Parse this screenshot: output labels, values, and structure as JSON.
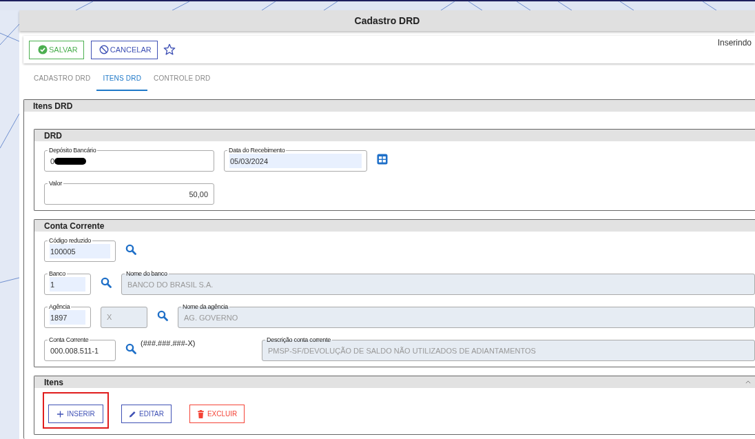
{
  "window": {
    "title": "Cadastro DRD"
  },
  "toolbar": {
    "buttons": [
      {
        "label": "SALVAR",
        "kind": "save"
      },
      {
        "label": "CANCELAR",
        "kind": "cancel"
      }
    ],
    "favorite": false,
    "mode": "Inserindo"
  },
  "tabs": [
    {
      "label": "CADASTRO DRD",
      "selected": false
    },
    {
      "label": "ITENS DRD",
      "selected": true
    },
    {
      "label": "CONTROLE DRD",
      "selected": false
    }
  ],
  "panel": {
    "title": "Itens DRD",
    "sections": [
      {
        "title": "DRD",
        "rows": [
          [
            {
              "kind": "field",
              "label": "Depósito Bancário",
              "value": "0",
              "redacted": true,
              "disabled": false,
              "autofill": false
            },
            {
              "kind": "field",
              "label": "Data do Recebimento",
              "value": "05/03/2024",
              "disabled": false,
              "autofill": true
            },
            {
              "kind": "calendar"
            }
          ],
          [
            {
              "kind": "field",
              "label": "Valor",
              "value": "50,00",
              "numeric": true,
              "disabled": false,
              "autofill": false
            }
          ]
        ]
      },
      {
        "title": "Conta Corrente",
        "rows": [
          [
            {
              "kind": "field",
              "label": "Código reduzido",
              "value": "100005",
              "disabled": false,
              "autofill": true
            },
            {
              "kind": "search"
            }
          ],
          [
            {
              "kind": "field",
              "label": "Banco",
              "value": "1",
              "disabled": false,
              "autofill": true
            },
            {
              "kind": "search"
            },
            {
              "kind": "field",
              "label": "Nome do banco",
              "value": "BANCO DO BRASIL S.A.",
              "disabled": true,
              "autofill": false
            }
          ],
          [
            {
              "kind": "field",
              "label": "Agência",
              "value": "1897",
              "disabled": false,
              "autofill": true
            },
            {
              "kind": "field",
              "value": "X",
              "disabled": true,
              "autofill": false
            },
            {
              "kind": "search"
            },
            {
              "kind": "field",
              "label": "Nome da agência",
              "value": "AG. GOVERNO",
              "disabled": true,
              "autofill": false
            }
          ],
          [
            {
              "kind": "field",
              "label": "Conta Corrente",
              "value": "000.008.511-1",
              "disabled": false,
              "autofill": false
            },
            {
              "kind": "search"
            },
            {
              "kind": "hint",
              "text": "(###.###.###-X)"
            },
            {
              "kind": "field",
              "label": "Descrição conta corrente",
              "value": "PMSP-SF/DEVOLUÇÃO DE SALDO NÃO UTILIZADOS DE ADIANTAMENTOS",
              "disabled": true,
              "autofill": false
            }
          ]
        ]
      }
    ]
  },
  "items_section": {
    "title": "Itens",
    "expanded": true,
    "buttons": [
      {
        "label": "INSERIR",
        "kind": "add",
        "highlighted": true
      },
      {
        "label": "EDITAR",
        "kind": "edit",
        "highlighted": false
      },
      {
        "label": "EXCLUIR",
        "kind": "delete",
        "highlighted": false
      }
    ]
  }
}
